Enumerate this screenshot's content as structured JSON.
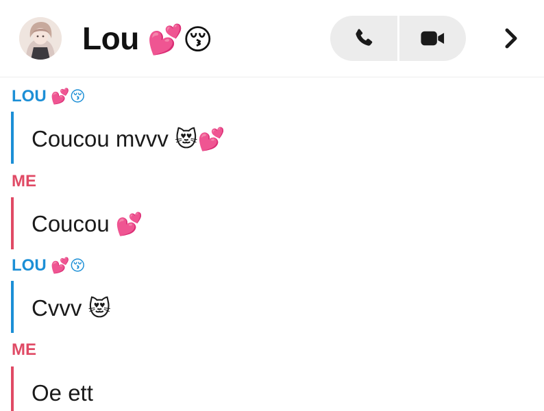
{
  "header": {
    "contact_name": "Lou",
    "name_emojis": "💕😚",
    "avatar_icon": "avatar-photo",
    "call_icon": "phone-icon",
    "video_icon": "video-camera-icon",
    "more_icon": "chevron-right-icon"
  },
  "colors": {
    "friend": "#1c8fd6",
    "me": "#e04a65",
    "text": "#1a1a1a",
    "button_bg": "#ececec"
  },
  "messages": [
    {
      "sender": "LOU",
      "sender_emojis": "💕😚",
      "text": "Coucou mvvv",
      "text_emojis": "😻💕"
    },
    {
      "sender": "ME",
      "sender_emojis": "",
      "text": "Coucou",
      "text_emojis": "💕"
    },
    {
      "sender": "LOU",
      "sender_emojis": "💕😚",
      "text": "Cvvv",
      "text_emojis": "😻"
    },
    {
      "sender": "ME",
      "sender_emojis": "",
      "text": "Oe ett",
      "text_emojis": ""
    }
  ]
}
